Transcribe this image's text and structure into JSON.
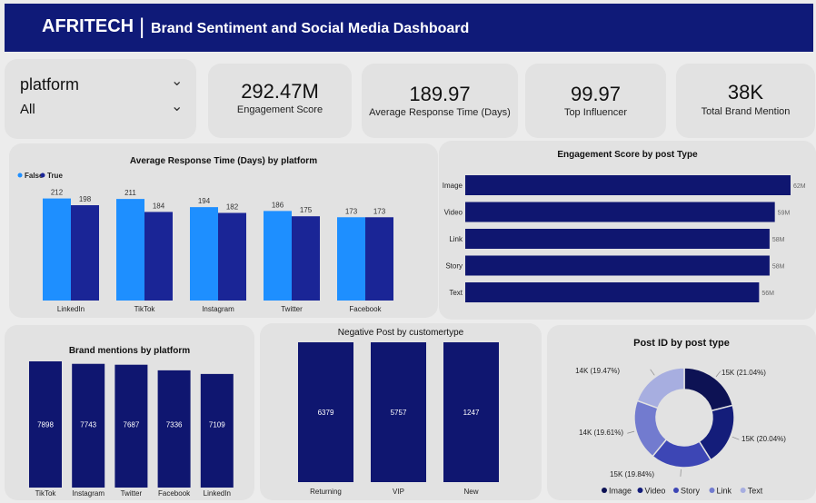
{
  "header": {
    "brand": "AFRITECH",
    "separator": "|",
    "subtitle": "Brand Sentiment and Social Media Dashboard"
  },
  "slicer": {
    "field": "platform",
    "value": "All"
  },
  "kpis": [
    {
      "value": "292.47M",
      "label": "Engagement Score"
    },
    {
      "value": "189.97",
      "label": "Average Response Time (Days)"
    },
    {
      "value": "99.97",
      "label": "Top Influencer"
    },
    {
      "value": "38K",
      "label": "Total Brand Mention"
    }
  ],
  "colors": {
    "header": "#0f1a78",
    "false_series": "#1e8fff",
    "true_series": "#1a2596",
    "bar_dark": "#0f1670",
    "donut": [
      "#0d1254",
      "#141d7a",
      "#3d46b5",
      "#727bcf",
      "#a7aee0"
    ]
  },
  "chart_data": [
    {
      "type": "bar",
      "title": "Average Response Time (Days) by platform",
      "categories": [
        "LinkedIn",
        "TikTok",
        "Instagram",
        "Twitter",
        "Facebook"
      ],
      "series": [
        {
          "name": "False",
          "values": [
            212,
            211,
            194,
            186,
            173
          ]
        },
        {
          "name": "True",
          "values": [
            198,
            184,
            182,
            175,
            173
          ]
        }
      ],
      "legend": "top-left"
    },
    {
      "type": "bar",
      "orientation": "horizontal",
      "title": "Engagement Score by post Type",
      "categories": [
        "Image",
        "Video",
        "Link",
        "Story",
        "Text"
      ],
      "values": [
        62,
        59,
        58,
        58,
        56
      ],
      "labels": [
        "62M",
        "59M",
        "58M",
        "58M",
        "56M"
      ]
    },
    {
      "type": "bar",
      "title": "Brand mentions by platform",
      "categories": [
        "TikTok",
        "Instagram",
        "Twitter",
        "Facebook",
        "LinkedIn"
      ],
      "values": [
        7898,
        7743,
        7687,
        7336,
        7109
      ]
    },
    {
      "type": "bar",
      "title": "Negative Post by customertype",
      "categories": [
        "Returning",
        "VIP",
        "New"
      ],
      "values": [
        6379,
        5757,
        1247
      ]
    },
    {
      "type": "pie",
      "title": "Post ID by post type",
      "categories": [
        "Image",
        "Video",
        "Story",
        "Link",
        "Text"
      ],
      "values": [
        21.04,
        20.04,
        19.84,
        19.61,
        19.47
      ],
      "labels": [
        "15K (21.04%)",
        "15K (20.04%)",
        "15K (19.84%)",
        "14K (19.61%)",
        "14K (19.47%)"
      ],
      "legend": "bottom"
    }
  ]
}
